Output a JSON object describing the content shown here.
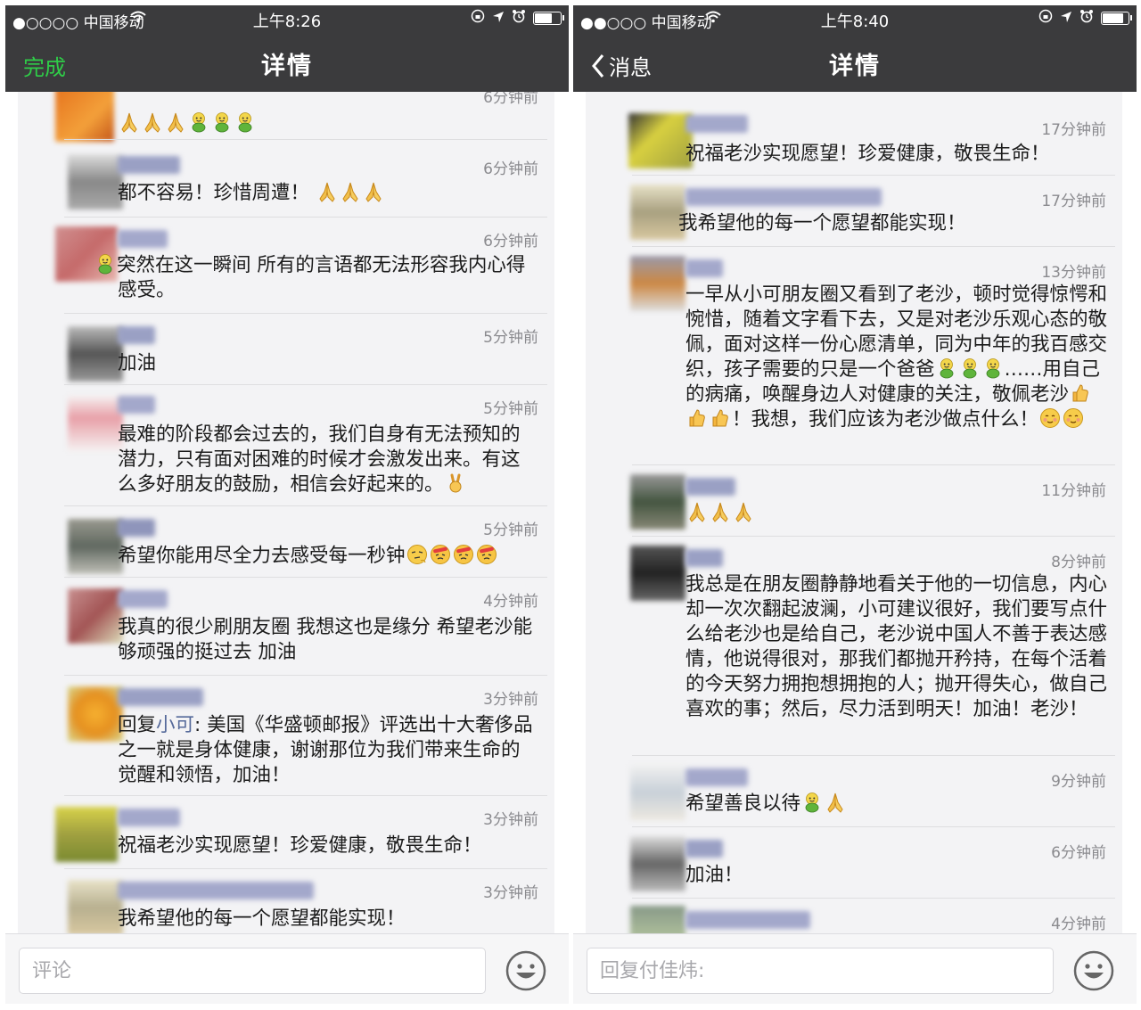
{
  "left_screen": {
    "status": {
      "carrier": "●○○○○ 中国移动",
      "time": "上午8:26"
    },
    "nav": {
      "left_button": "完成",
      "title": "详情"
    },
    "comments": [
      {
        "time": "6分钟前",
        "text": ""
      },
      {
        "time": "6分钟前",
        "text": "都不容易！珍惜周遭！"
      },
      {
        "time": "6分钟前",
        "text": "突然在这一瞬间 所有的言语都无法形容我内心得感受。"
      },
      {
        "time": "5分钟前",
        "text": "加油"
      },
      {
        "time": "5分钟前",
        "text": "最难的阶段都会过去的，我们自身有无法预知的潜力，只有面对困难的时候才会激发出来。有这么多好朋友的鼓励，相信会好起来的。"
      },
      {
        "time": "5分钟前",
        "text": "希望你能用尽全力去感受每一秒钟"
      },
      {
        "time": "4分钟前",
        "text": "我真的很少刷朋友圈 我想这也是缘分 希望老沙能够顽强的挺过去 加油"
      },
      {
        "time": "3分钟前",
        "reply_prefix": "回复",
        "reply_to": "小可",
        "text": ": 美国《华盛顿邮报》评选出十大奢侈品之一就是身体健康，谢谢那位为我们带来生命的觉醒和领悟，加油！"
      },
      {
        "time": "3分钟前",
        "text": "祝福老沙实现愿望！珍爱健康，敬畏生命！"
      },
      {
        "time": "3分钟前",
        "text": "我希望他的每一个愿望都能实现！"
      }
    ],
    "input_placeholder": "评论"
  },
  "right_screen": {
    "status": {
      "carrier": "●●○○○ 中国移动",
      "time": "上午8:40"
    },
    "nav": {
      "back_label": "消息",
      "title": "详情"
    },
    "comments": [
      {
        "time": "17分钟前",
        "text": "祝福老沙实现愿望！珍爱健康，敬畏生命！"
      },
      {
        "time": "17分钟前",
        "text": "我希望他的每一个愿望都能实现！"
      },
      {
        "time": "13分钟前",
        "text_a": "一早从小可朋友圈又看到了老沙，顿时觉得惊愕和惋惜，随着文字看下去，又是对老沙乐观心态的敬佩，面对这样一份心愿清单，同为中年的我百感交织，孩子需要的只是一个爸爸",
        "text_b": "……用自己的病痛，唤醒身边人对健康的关注，敬佩老沙",
        "text_c": "！我想，我们应该为老沙做点什么！"
      },
      {
        "time": "11分钟前",
        "text": ""
      },
      {
        "time": "8分钟前",
        "text": "我总是在朋友圈静静地看关于他的一切信息，内心却一次次翻起波澜，小可建议很好，我们要写点什么给老沙也是给自己，老沙说中国人不善于表达感情，他说得很对，那我们都抛开矜持，在每个活着的今天努力拥抱想拥抱的人；抛开得失心，做自己喜欢的事；然后，尽力活到明天！加油！老沙！"
      },
      {
        "time": "9分钟前",
        "text": "希望善良以待"
      },
      {
        "time": "6分钟前",
        "text": "加油！"
      },
      {
        "time": "4分钟前",
        "text": ""
      }
    ],
    "input_placeholder": "回复付佳炜:"
  }
}
